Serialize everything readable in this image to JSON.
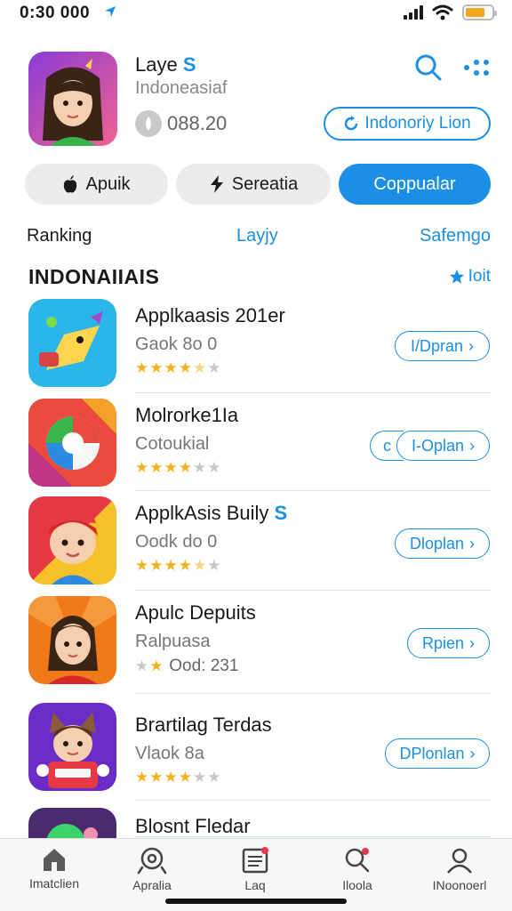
{
  "status_bar": {
    "time": "0:30 000",
    "signal_bars": 4,
    "battery_level": 0.75,
    "battery_color": "#f2a51f"
  },
  "header": {
    "title": "Laye",
    "title_badge": "S",
    "subtitle": "Indoneasiaf",
    "count": "088.20",
    "install_label": "Indonoriy Lion",
    "search_icon": "search-icon",
    "more_icon": "more-icon"
  },
  "segments": [
    {
      "label": "Apuik",
      "icon": "apple-icon"
    },
    {
      "label": "Sereatia",
      "icon": "bolt-icon"
    },
    {
      "label": "Coppualar",
      "icon": ""
    }
  ],
  "tabs": {
    "left": "Ranking",
    "middle": "Layjy",
    "right": "Safemgo"
  },
  "section": {
    "title": "INDONAIIAIS",
    "link": "Ioit"
  },
  "apps": [
    {
      "title": "Applkaasis 201er",
      "badge": "",
      "subtitle": "Gaok 8o 0",
      "stars": 4.5,
      "rating_text": "",
      "button": "I/Dpran",
      "button_prefix": ""
    },
    {
      "title": "Molrorke1Ia",
      "badge": "",
      "subtitle": "Cotoukial",
      "stars": 4,
      "rating_text": "",
      "button": "I-Oplan",
      "button_prefix": "c"
    },
    {
      "title": "ApplkAsis Buily",
      "badge": "S",
      "subtitle": "Oodk do 0",
      "stars": 4.5,
      "rating_text": "",
      "button": "Dloplan",
      "button_prefix": ""
    },
    {
      "title": "Apulc Depuits",
      "badge": "",
      "subtitle": "Ralpuasa",
      "stars": 2,
      "rating_text": "Ood: 231",
      "button": "Rpien",
      "button_prefix": ""
    },
    {
      "title": "Brartilag Terdas",
      "badge": "",
      "subtitle": "Vlaok 8a",
      "stars": 4,
      "rating_text": "",
      "button": "DPlonlan",
      "button_prefix": ""
    },
    {
      "title": "Blosnt Fledar",
      "badge": "",
      "subtitle": "",
      "stars": 0,
      "rating_text": "",
      "button": "",
      "button_prefix": ""
    }
  ],
  "nav": [
    {
      "label": "Imatclien",
      "icon": "home-icon"
    },
    {
      "label": "Apralia",
      "icon": "explore-icon"
    },
    {
      "label": "Laq",
      "icon": "list-icon"
    },
    {
      "label": "Iloola",
      "icon": "search-notify-icon"
    },
    {
      "label": "INoonoerl",
      "icon": "profile-icon"
    }
  ],
  "colors": {
    "accent": "#1b8ee5",
    "star": "#f2b21f"
  }
}
